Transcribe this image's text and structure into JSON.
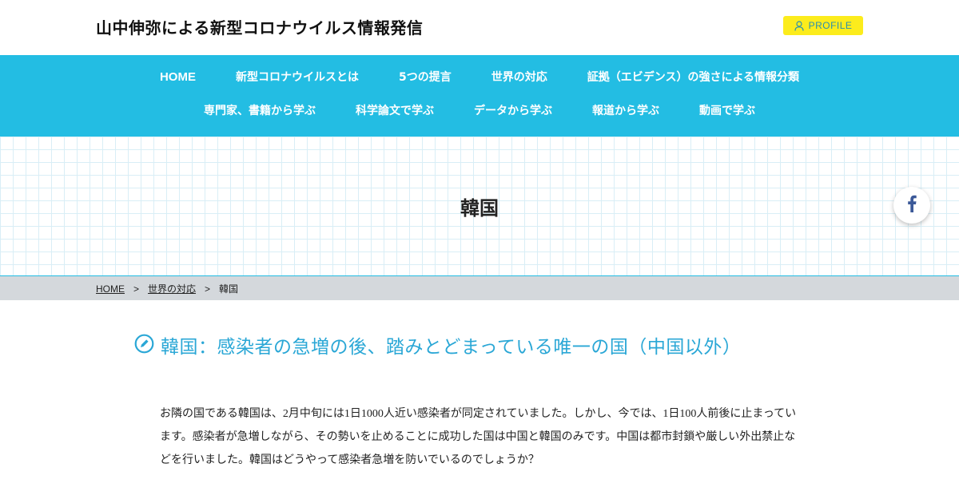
{
  "site": {
    "title": "山中伸弥による新型コロナウイルス情報発信",
    "profile_label": "PROFILE"
  },
  "nav": {
    "row1": [
      "HOME",
      "新型コロナウイルスとは",
      "5つの提言",
      "世界の対応",
      "証拠（エビデンス）の強さによる情報分類"
    ],
    "row2": [
      "専門家、書籍から学ぶ",
      "科学論文で学ぶ",
      "データから学ぶ",
      "報道から学ぶ",
      "動画で学ぶ"
    ]
  },
  "hero": {
    "title": "韓国"
  },
  "breadcrumb": {
    "home": "HOME",
    "sep": ">",
    "parent": "世界の対応",
    "current": "韓国"
  },
  "article": {
    "heading": "韓国：感染者の急増の後、踏みとどまっている唯一の国（中国以外）",
    "body": "お隣の国である韓国は、2月中旬には1日1000人近い感染者が同定されていました。しかし、今では、1日100人前後に止まっています。感染者が急増しながら、その勢いを止めることに成功した国は中国と韓国のみです。中国は都市封鎖や厳しい外出禁止などを行いました。韓国はどうやって感染者急増を防いでいるのでしょうか？"
  },
  "colors": {
    "accent": "#23bde3",
    "heading": "#2aa7d6",
    "profile_bg": "#fcec1c",
    "breadcrumb_bg": "#d4d8dc",
    "facebook": "#3b5998"
  },
  "icons": {
    "profile": "user-icon",
    "social": "facebook-icon",
    "heading": "pencil-circle-icon"
  }
}
